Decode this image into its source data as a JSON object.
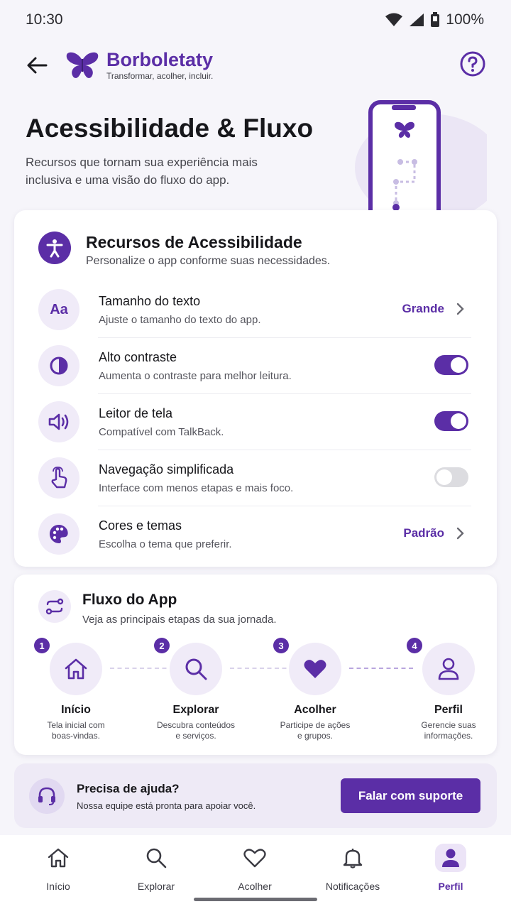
{
  "status_bar": {
    "time": "10:30",
    "battery": "100%"
  },
  "header": {
    "brand": "Borboletaty",
    "tagline": "Transformar, acolher, incluir."
  },
  "hero": {
    "title": "Acessibilidade & Fluxo",
    "subtitle": "Recursos que tornam sua experiência mais inclusiva e uma visão do fluxo do app."
  },
  "accessibility": {
    "title": "Recursos de Acessibilidade",
    "subtitle": "Personalize o app conforme suas necessidades.",
    "items": [
      {
        "icon": "text-size-icon",
        "glyph": "Aa",
        "title": "Tamanho do texto",
        "subtitle": "Ajuste o tamanho do texto do app.",
        "value": "Grande"
      },
      {
        "icon": "contrast-icon",
        "title": "Alto contraste",
        "subtitle": "Aumenta o contraste para melhor leitura.",
        "toggle": true
      },
      {
        "icon": "speaker-icon",
        "title": "Leitor de tela",
        "subtitle": "Compatível com TalkBack.",
        "toggle": true
      },
      {
        "icon": "touch-hand-icon",
        "title": "Navegação simplificada",
        "subtitle": "Interface com menos etapas e mais foco.",
        "toggle": false
      },
      {
        "icon": "palette-icon",
        "title": "Cores e temas",
        "subtitle": "Escolha o tema que preferir.",
        "value": "Padrão"
      }
    ]
  },
  "flow": {
    "title": "Fluxo do App",
    "subtitle": "Veja as principais etapas da sua jornada.",
    "steps": [
      {
        "number": "1",
        "icon": "home-icon",
        "label": "Início",
        "desc1": "Tela inicial com",
        "desc2": "boas-vindas."
      },
      {
        "number": "2",
        "icon": "search-icon",
        "label": "Explorar",
        "desc1": "Descubra conteúdos",
        "desc2": "e serviços."
      },
      {
        "number": "3",
        "icon": "heart-icon",
        "label": "Acolher",
        "desc1": "Participe de ações",
        "desc2": "e grupos."
      },
      {
        "number": "4",
        "icon": "person-icon",
        "label": "Perfil",
        "desc1": "Gerencie suas",
        "desc2": "informações."
      }
    ]
  },
  "help": {
    "title": "Precisa de ajuda?",
    "subtitle": "Nossa equipe está pronta para apoiar você.",
    "button": "Falar com suporte"
  },
  "nav": {
    "items": [
      {
        "icon": "home-icon",
        "label": "Início"
      },
      {
        "icon": "search-icon",
        "label": "Explorar"
      },
      {
        "icon": "heart-icon",
        "label": "Acolher"
      },
      {
        "icon": "bell-icon",
        "label": "Notificações"
      },
      {
        "icon": "person-icon",
        "label": "Perfil",
        "active": true
      }
    ]
  },
  "colors": {
    "accent": "#5b2ea6",
    "accent_soft": "#f0ebf8",
    "background": "#f6f5fa"
  }
}
